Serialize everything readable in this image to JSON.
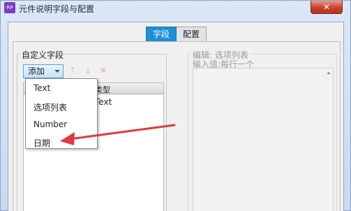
{
  "window": {
    "app_icon_text": "RP",
    "title": "元件说明字段与配置",
    "close_symbol": "✕"
  },
  "tabs": [
    {
      "label": "字段",
      "active": true
    },
    {
      "label": "配置",
      "active": false
    }
  ],
  "fields_group": {
    "legend": "自定义字段",
    "add_button_label": "添加",
    "toolbar_icons": [
      "arrow-up-icon",
      "arrow-down-icon",
      "delete-icon"
    ],
    "columns": [
      "类型"
    ],
    "rows": [
      {
        "type": "Text"
      }
    ]
  },
  "add_menu": {
    "items": [
      "Text",
      "选项列表",
      "Number",
      "日期"
    ]
  },
  "edit_group": {
    "legend": "编辑: 选项列表",
    "hint": "输入值:每行一个"
  },
  "colors": {
    "active_tab": "#1e8fd6",
    "annotation_arrow": "#e0393b",
    "close_button": "#c8412b"
  }
}
